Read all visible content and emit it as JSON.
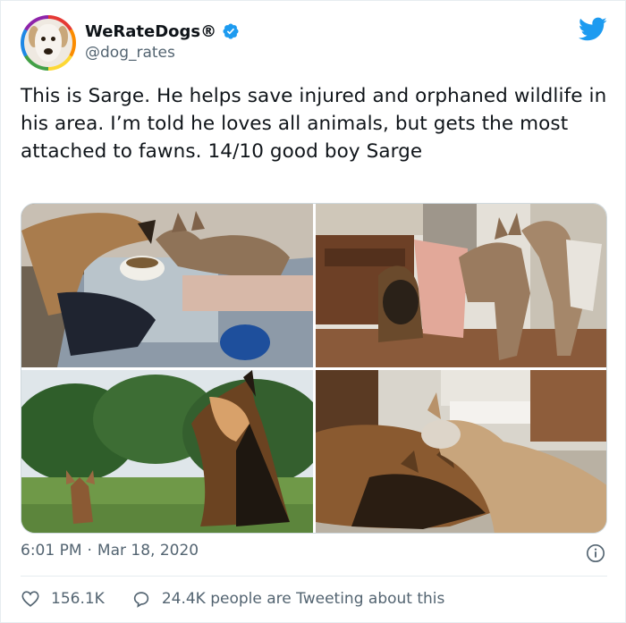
{
  "account": {
    "display_name": "WeRateDogs®",
    "handle": "@dog_rates",
    "verified_icon": "verified-badge-icon",
    "avatar_icon": "dog-avatar"
  },
  "brand": {
    "logo_icon": "twitter-bird-icon",
    "accent": "#1d9bf0"
  },
  "tweet": {
    "text": "This is Sarge. He helps save injured and orphaned wildlife in his area. I’m told he loves all animals, but gets the most attached to fawns. 14/10 good boy Sarge",
    "media": [
      {
        "name": "photo-dog-fawn-eating"
      },
      {
        "name": "photo-dog-two-deer-indoors"
      },
      {
        "name": "photo-dog-fawn-outdoors"
      },
      {
        "name": "photo-dog-deer-cuddling"
      }
    ]
  },
  "meta": {
    "time": "6:01 PM",
    "separator": "·",
    "date": "Mar 18, 2020",
    "info_icon": "info-icon"
  },
  "engagement": {
    "likes": "156.1K",
    "like_icon": "heart-icon",
    "conversation": "24.4K people are Tweeting about this",
    "conversation_icon": "speech-bubble-icon"
  }
}
